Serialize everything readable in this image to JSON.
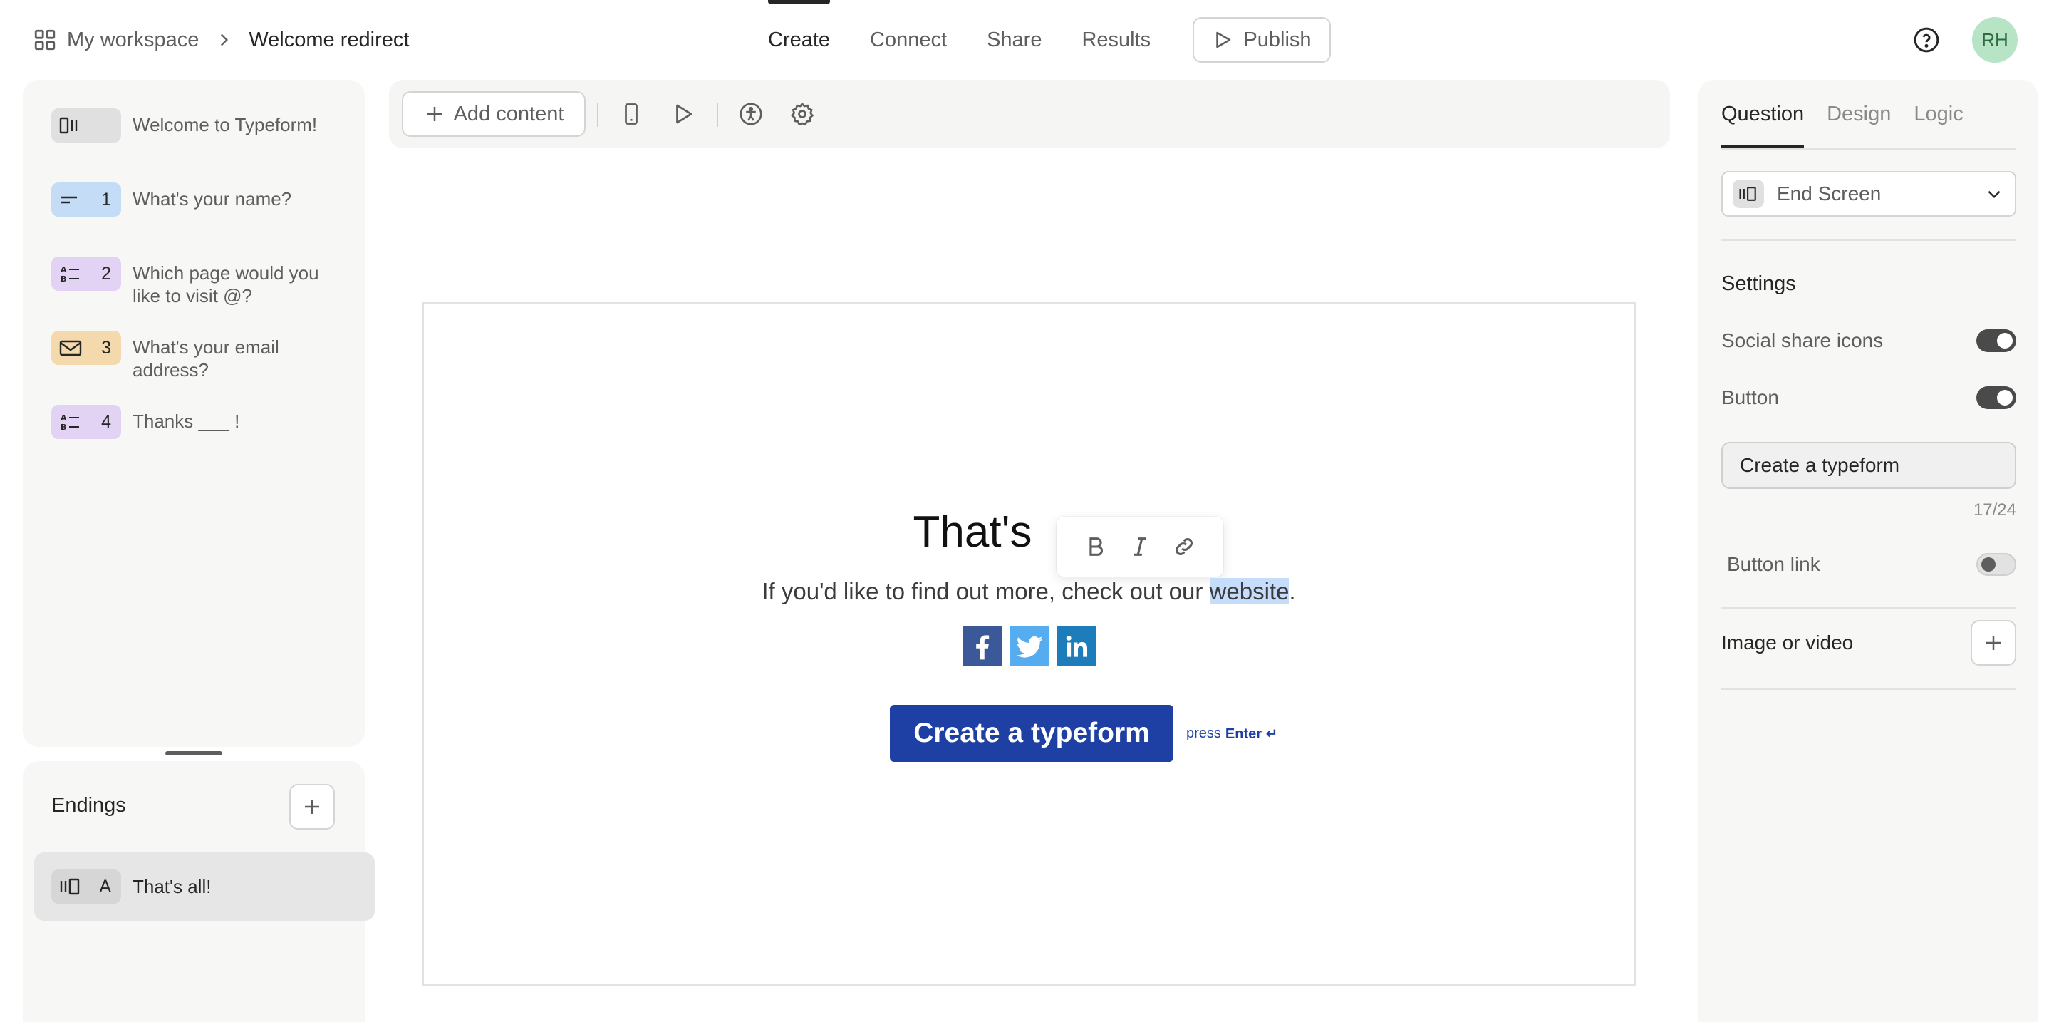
{
  "breadcrumb": {
    "workspace": "My workspace",
    "form_name": "Welcome redirect"
  },
  "nav": {
    "tabs": [
      "Create",
      "Connect",
      "Share",
      "Results"
    ],
    "active": "Create",
    "publish_label": "Publish"
  },
  "user": {
    "initials": "RH"
  },
  "questions": [
    {
      "number": "",
      "text": "Welcome to Typeform!",
      "icon": "welcome-screen-icon",
      "color": "#e0e0e0"
    },
    {
      "number": "1",
      "text": "What's your name?",
      "icon": "short-text-icon",
      "color": "#c4dcf6"
    },
    {
      "number": "2",
      "text": "Which page would you like to visit @?",
      "icon": "multiple-choice-icon",
      "color": "#e2d2f4"
    },
    {
      "number": "3",
      "text": "What's your email address?",
      "icon": "email-icon",
      "color": "#f3d9ac"
    },
    {
      "number": "4",
      "text": "Thanks ___ !",
      "icon": "multiple-choice-icon",
      "color": "#e2d2f4"
    }
  ],
  "endings": {
    "title": "Endings",
    "items": [
      {
        "letter": "A",
        "text": "That's all!",
        "icon": "end-screen-icon"
      }
    ]
  },
  "toolbar": {
    "add_content_label": "Add content"
  },
  "preview": {
    "title_visible": "That's",
    "description_before": "If you'd like to find out more, check out our ",
    "description_highlight": "website",
    "description_after": ".",
    "button_label": "Create a typeform",
    "press_label": "press",
    "enter_label": "Enter ↵"
  },
  "right_panel": {
    "tabs": [
      "Question",
      "Design",
      "Logic"
    ],
    "active_tab": "Question",
    "type_value": "End Screen",
    "settings_title": "Settings",
    "social_share_label": "Social share icons",
    "social_share_on": true,
    "button_setting_label": "Button",
    "button_setting_on": true,
    "button_text_value": "Create a typeform",
    "char_count": "17/24",
    "button_link_label": "Button link",
    "button_link_on": false,
    "image_video_label": "Image or video"
  },
  "colors": {
    "cta": "#1e40a4",
    "accent_dark": "#262627",
    "highlight": "#c6dcfb"
  }
}
